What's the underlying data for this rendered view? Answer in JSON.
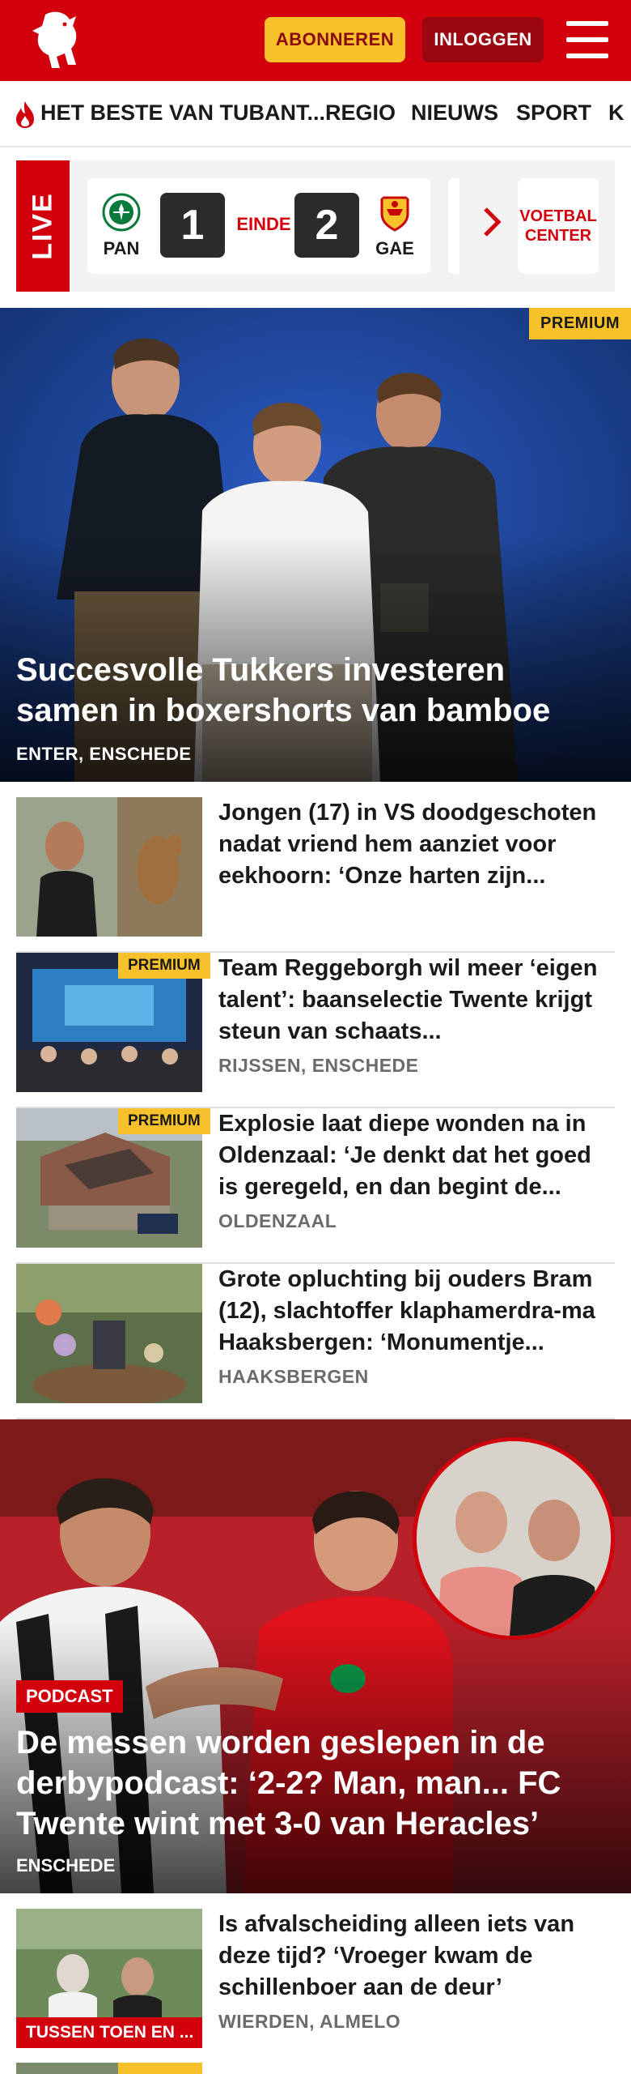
{
  "header": {
    "subscribe_label": "ABONNEREN",
    "login_label": "INLOGGEN"
  },
  "nav": {
    "items": [
      "HET BESTE VAN TUBANT...",
      "REGIO",
      "NIEUWS",
      "SPORT",
      "K"
    ]
  },
  "live": {
    "label": "LIVE",
    "match": {
      "home_team": "PAN",
      "away_team": "GAE",
      "home_score": "1",
      "away_score": "2",
      "status": "EINDE"
    },
    "voetbal_center_label": "VOETBAL CENTER"
  },
  "hero": {
    "badge": "PREMIUM",
    "title": "Succesvolle Tukkers investeren samen in boxershorts van bamboe",
    "location": "ENTER, ENSCHEDE"
  },
  "articles": [
    {
      "title": "Jongen (17) in VS doodgeschoten nadat vriend hem aanziet voor eekhoorn: ‘Onze harten zijn...",
      "location": "",
      "badge": ""
    },
    {
      "title": "Team Reggeborgh wil meer ‘eigen talent’: baanselectie Twente krijgt steun van schaats...",
      "location": "RIJSSEN, ENSCHEDE",
      "badge": "PREMIUM"
    },
    {
      "title": "Explosie laat diepe wonden na in Oldenzaal: ‘Je denkt dat het goed is geregeld, en dan begint de...",
      "location": "OLDENZAAL",
      "badge": "PREMIUM"
    },
    {
      "title": "Grote opluchting bij ouders Bram (12), slachtoffer klaphamerdra-ma Haaksbergen: ‘Monumentje...",
      "location": "HAAKSBERGEN",
      "badge": ""
    }
  ],
  "podcast": {
    "badge": "PODCAST",
    "title": "De messen worden geslepen in de derbypodcast: ‘2-2? Man, man... FC Twente wint met 3-0 van Heracles’",
    "location": "ENSCHEDE"
  },
  "article_bottom": {
    "title": "Is afvalscheiding alleen iets van deze tijd? ‘Vroeger kwam de schillenboer aan de deur’",
    "location": "WIERDEN, ALMELO",
    "badge": "TUSSEN TOEN EN ..."
  },
  "article_cut": {
    "badge": "PREMIUM"
  },
  "colors": {
    "brand_red": "#d1000c",
    "premium_yellow": "#f6c12b",
    "dark_red": "#9b0710"
  }
}
